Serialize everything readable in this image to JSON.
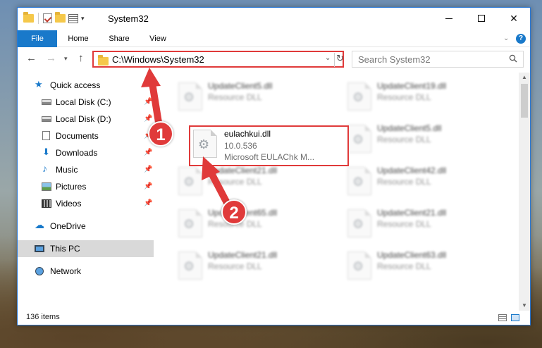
{
  "window": {
    "title": "System32"
  },
  "ribbon": {
    "tabs": [
      {
        "label": "File"
      },
      {
        "label": "Home"
      },
      {
        "label": "Share"
      },
      {
        "label": "View"
      }
    ]
  },
  "address": {
    "path": "C:\\Windows\\System32"
  },
  "search": {
    "placeholder": "Search System32"
  },
  "navpane": {
    "items": [
      {
        "label": "Quick access"
      },
      {
        "label": "Local Disk (C:)"
      },
      {
        "label": "Local Disk (D:)"
      },
      {
        "label": "Documents"
      },
      {
        "label": "Downloads"
      },
      {
        "label": "Music"
      },
      {
        "label": "Pictures"
      },
      {
        "label": "Videos"
      },
      {
        "label": "OneDrive"
      },
      {
        "label": "This PC"
      },
      {
        "label": "Network"
      }
    ]
  },
  "files": {
    "highlighted": {
      "name": "eulachkui.dll",
      "version": "10.0.536",
      "description": "Microsoft EULAChk M..."
    },
    "blurred": [
      {
        "name": "UpdateClient5.dll",
        "type": "Resource DLL"
      },
      {
        "name": "UpdateClient19.dll",
        "type": "Resource DLL"
      },
      {
        "name": "UpdateClient5.dll",
        "type": "Resource DLL"
      },
      {
        "name": "UpdateClient21.dll",
        "type": "Resource DLL"
      },
      {
        "name": "UpdateClient42.dll",
        "type": "Resource DLL"
      },
      {
        "name": "UpdateClient65.dll",
        "type": "Resource DLL"
      },
      {
        "name": "UpdateClient21.dll",
        "type": "Resource DLL"
      },
      {
        "name": "UpdateClient21.dll",
        "type": "Resource DLL"
      },
      {
        "name": "UpdateClient63.dll",
        "type": "Resource DLL"
      }
    ]
  },
  "status": {
    "item_count": "136 items"
  },
  "annotations": {
    "badge1": "1",
    "badge2": "2"
  }
}
